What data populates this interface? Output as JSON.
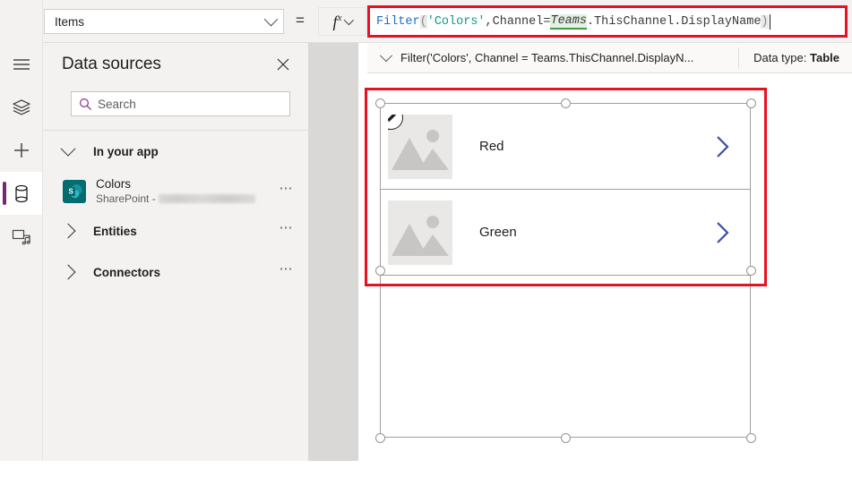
{
  "formula_bar": {
    "property_dropdown": {
      "value": "Items",
      "chevron_icon": "chevron-down-icon"
    },
    "equals_sign": "=",
    "fx_button": {
      "label": "fx",
      "superscript": "x",
      "chevron_icon": "chevron-down-icon"
    },
    "formula": {
      "full_text": "Filter('Colors', Channel = Teams.ThisChannel.DisplayName)",
      "tokens": {
        "fn": "Filter",
        "open_paren": "(",
        "table": "'Colors'",
        "comma_space": ", ",
        "column": "Channel",
        "operator": " = ",
        "object": "Teams",
        "member": ".ThisChannel.DisplayName",
        "close_paren": ")"
      }
    }
  },
  "info_bar": {
    "chevron_icon": "chevron-down-icon",
    "formula_preview": "Filter('Colors', Channel = Teams.ThisChannel.DisplayN...",
    "data_type_label": "Data type:",
    "data_type_value": "Table"
  },
  "icon_rail": {
    "items": [
      {
        "name": "hamburger-menu",
        "icon": "hamburger-icon",
        "selected": false
      },
      {
        "name": "tree-view",
        "icon": "layers-icon",
        "selected": false
      },
      {
        "name": "insert",
        "icon": "plus-icon",
        "selected": false
      },
      {
        "name": "data",
        "icon": "database-icon",
        "selected": true
      },
      {
        "name": "media",
        "icon": "media-icon",
        "selected": false
      }
    ],
    "selection_accent": "#742774"
  },
  "data_sources_panel": {
    "title": "Data sources",
    "close_icon": "close-icon",
    "search": {
      "placeholder": "Search",
      "value": "",
      "icon": "search-icon"
    },
    "groups": [
      {
        "label": "In your app",
        "expanded": true,
        "chevron_icon": "chevron-down-icon",
        "more_icon": "more-options-icon",
        "more_label": "⋯"
      },
      {
        "label": "Entities",
        "expanded": false,
        "chevron_icon": "chevron-right-icon",
        "more_icon": "more-options-icon",
        "more_label": "⋯"
      },
      {
        "label": "Connectors",
        "expanded": false,
        "chevron_icon": "chevron-right-icon",
        "more_icon": "more-options-icon",
        "more_label": "⋯"
      }
    ],
    "items": [
      {
        "name": "Colors",
        "subtitle_prefix": "SharePoint -",
        "subtitle_redacted": true,
        "icon": "sharepoint-icon",
        "icon_color": "#036c70",
        "more_label": "⋯"
      }
    ]
  },
  "canvas": {
    "gallery": {
      "selected": true,
      "edit_badge_icon": "pencil-icon",
      "rows": [
        {
          "label": "Red",
          "thumbnail_icon": "image-placeholder-icon",
          "chevron_icon": "chevron-right-icon"
        },
        {
          "label": "Green",
          "thumbnail_icon": "image-placeholder-icon",
          "chevron_icon": "chevron-right-icon"
        }
      ]
    }
  },
  "annotations": {
    "color": "#e81123",
    "boxes": [
      {
        "target": "formula-input"
      },
      {
        "target": "gallery-rows"
      }
    ]
  },
  "colors": {
    "panel_bg": "#f3f2f1",
    "gutter": "#d9d8d6",
    "canvas": "#ffffff",
    "accent_purple": "#742774",
    "sharepoint_teal": "#036c70",
    "annotation_red": "#e81123",
    "formula_fn_blue": "#1f6fc4",
    "formula_string_teal": "#0a9a8d",
    "teams_token_bg": "#e4f0e3",
    "teams_token_underline": "#3f9d40",
    "chevron_blue": "#3b4ea8"
  }
}
